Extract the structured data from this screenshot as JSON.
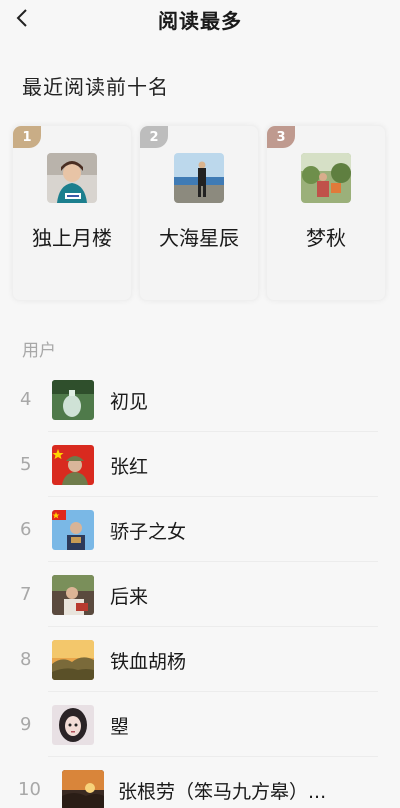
{
  "header": {
    "title": "阅读最多",
    "back_icon": "chevron-left-icon"
  },
  "top_section": {
    "title": "最近阅读前十名"
  },
  "top_three": [
    {
      "rank": "1",
      "name": "独上月楼",
      "badge_color": "#c9ad86"
    },
    {
      "rank": "2",
      "name": "大海星辰",
      "badge_color": "#bdbdbd"
    },
    {
      "rank": "3",
      "name": "梦秋",
      "badge_color": "#bf9a8f"
    }
  ],
  "users_section": {
    "label": "用户"
  },
  "users": [
    {
      "rank": "4",
      "name": "初见"
    },
    {
      "rank": "5",
      "name": "张红"
    },
    {
      "rank": "6",
      "name": "骄子之女"
    },
    {
      "rank": "7",
      "name": "后来"
    },
    {
      "rank": "8",
      "name": "铁血胡杨"
    },
    {
      "rank": "9",
      "name": "曌"
    },
    {
      "rank": "10",
      "name": "张根劳（笨马九方皋）..."
    }
  ]
}
